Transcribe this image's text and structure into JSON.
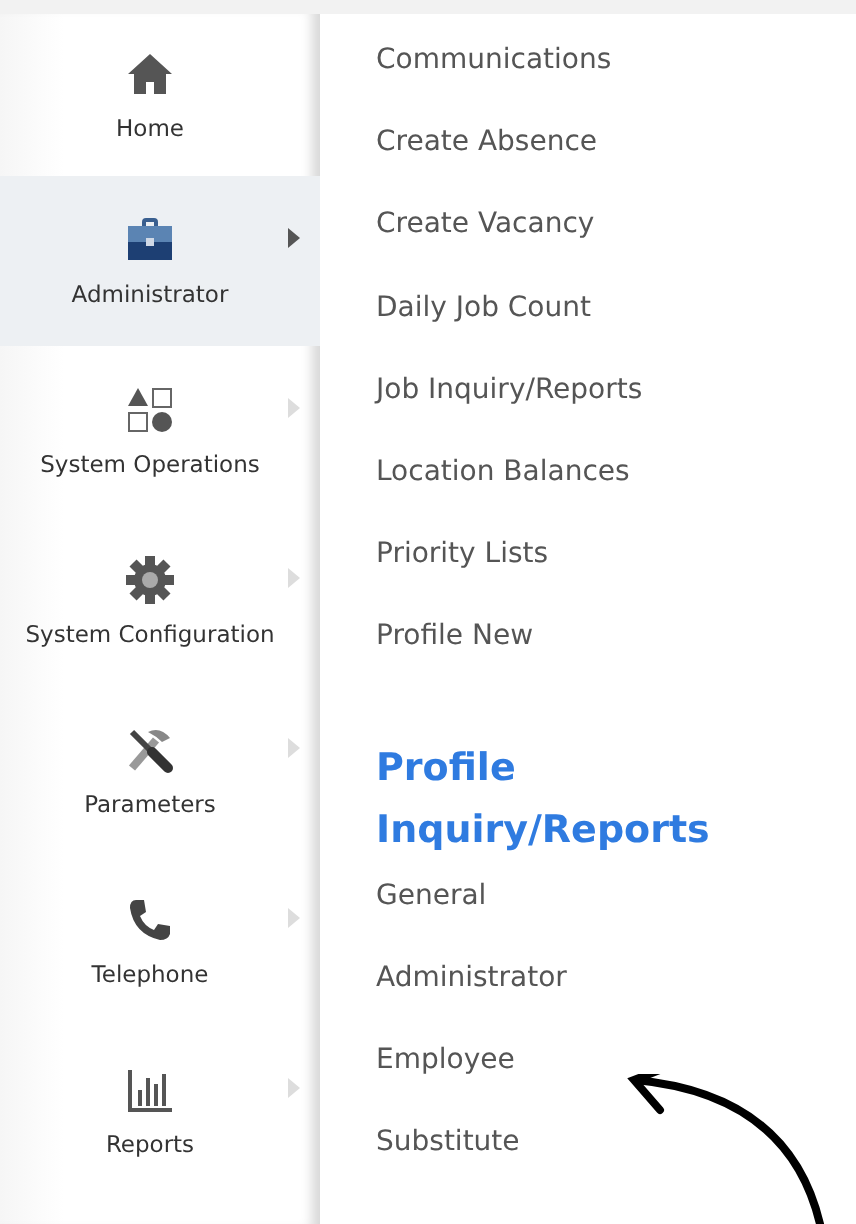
{
  "sidebar": {
    "items": [
      {
        "label": "Home",
        "selected": false,
        "has_submenu": false
      },
      {
        "label": "Administrator",
        "selected": true,
        "has_submenu": true
      },
      {
        "label": "System Operations",
        "selected": false,
        "has_submenu": true
      },
      {
        "label": "System Configuration",
        "selected": false,
        "has_submenu": true
      },
      {
        "label": "Parameters",
        "selected": false,
        "has_submenu": true
      },
      {
        "label": "Telephone",
        "selected": false,
        "has_submenu": true
      },
      {
        "label": "Reports",
        "selected": false,
        "has_submenu": true
      }
    ]
  },
  "submenu": {
    "items": [
      {
        "kind": "link",
        "label": "Communications"
      },
      {
        "kind": "link",
        "label": "Create Absence"
      },
      {
        "kind": "link",
        "label": "Create Vacancy"
      },
      {
        "kind": "link",
        "label": "Daily Job Count"
      },
      {
        "kind": "link",
        "label": "Job Inquiry/Reports"
      },
      {
        "kind": "link",
        "label": "Location Balances"
      },
      {
        "kind": "link",
        "label": "Priority Lists"
      },
      {
        "kind": "link",
        "label": "Profile New"
      },
      {
        "kind": "heading",
        "label": "Profile Inquiry/Reports"
      },
      {
        "kind": "link",
        "label": "General"
      },
      {
        "kind": "link",
        "label": "Administrator"
      },
      {
        "kind": "link",
        "label": "Employee"
      },
      {
        "kind": "link",
        "label": "Substitute"
      }
    ]
  }
}
